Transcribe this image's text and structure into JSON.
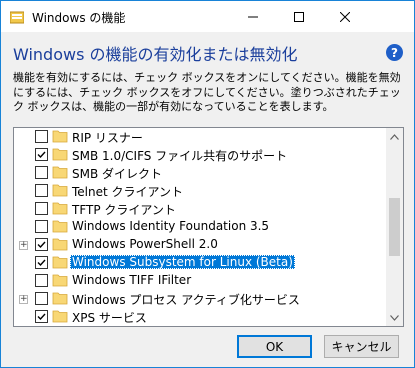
{
  "window": {
    "title": "Windows の機能",
    "heading": "Windows の機能の有効化または無効化",
    "help_label": "?",
    "description": "機能を有効にするには、チェック ボックスをオンにしてください。機能を無効にするには、チェック ボックスをオフにしてください。塗りつぶされたチェック ボックスは、機能の一部が有効になっていることを表します。"
  },
  "features": [
    {
      "label": "RIP リスナー",
      "checked": false,
      "expandable": false,
      "selected": false
    },
    {
      "label": "SMB 1.0/CIFS ファイル共有のサポート",
      "checked": true,
      "expandable": false,
      "selected": false
    },
    {
      "label": "SMB ダイレクト",
      "checked": false,
      "expandable": false,
      "selected": false
    },
    {
      "label": "Telnet クライアント",
      "checked": false,
      "expandable": false,
      "selected": false
    },
    {
      "label": "TFTP クライアント",
      "checked": false,
      "expandable": false,
      "selected": false
    },
    {
      "label": "Windows Identity Foundation 3.5",
      "checked": false,
      "expandable": false,
      "selected": false
    },
    {
      "label": "Windows PowerShell 2.0",
      "checked": true,
      "expandable": true,
      "selected": false
    },
    {
      "label": "Windows Subsystem for Linux (Beta)",
      "checked": true,
      "expandable": false,
      "selected": true
    },
    {
      "label": "Windows TIFF IFilter",
      "checked": false,
      "expandable": false,
      "selected": false
    },
    {
      "label": "Windows プロセス アクティブ化サービス",
      "checked": false,
      "expandable": true,
      "selected": false
    },
    {
      "label": "XPS サービス",
      "checked": true,
      "expandable": false,
      "selected": false
    }
  ],
  "buttons": {
    "ok": "OK",
    "cancel": "キャンセル"
  },
  "colors": {
    "accent": "#0078d7",
    "heading": "#1b3f9c",
    "folder": "#f8d775"
  }
}
